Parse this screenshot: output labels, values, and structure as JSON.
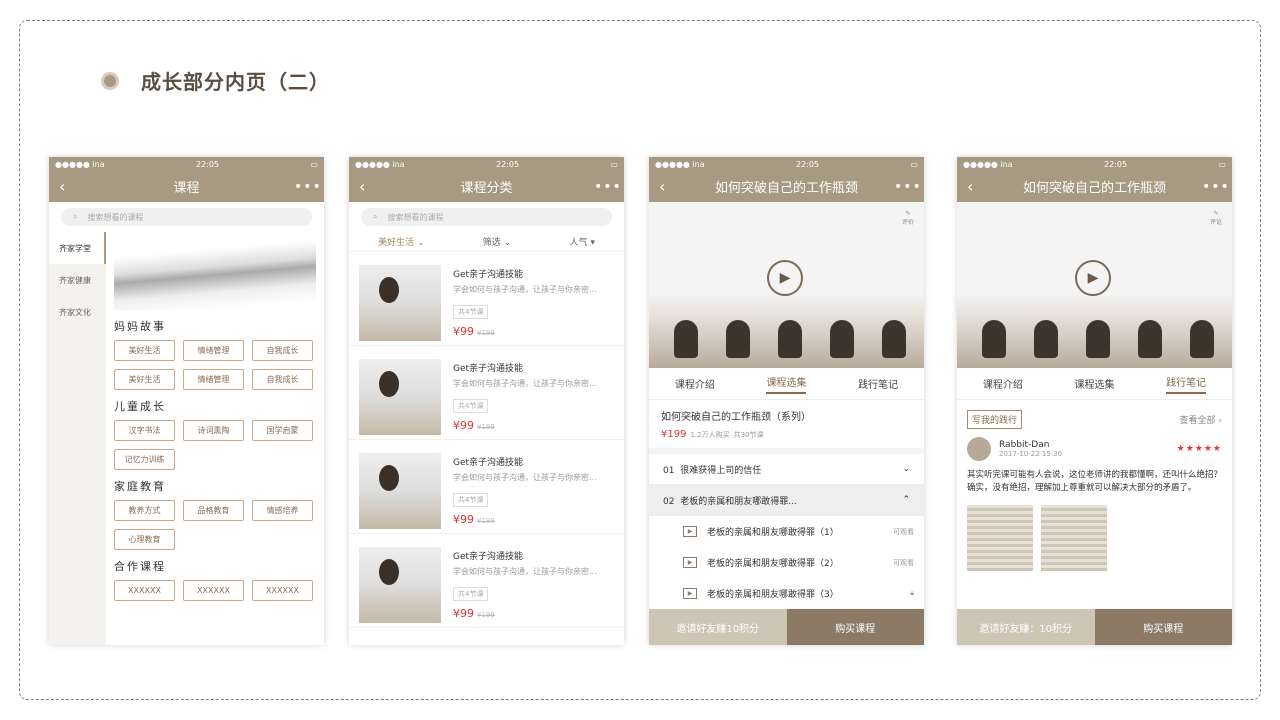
{
  "page": {
    "title": "成长部分内页（二）"
  },
  "status": {
    "carrier": "●●●●● ina",
    "time": "22:05"
  },
  "phone1": {
    "nav_title": "课程",
    "search_placeholder": "搜索想看的课程",
    "categories": [
      "齐家学堂",
      "齐家健康",
      "齐家文化"
    ],
    "sections": [
      {
        "title": "妈妈故事",
        "tags": [
          "美好生活",
          "情绪管理",
          "自我成长",
          "美好生活",
          "情绪管理",
          "自我成长"
        ]
      },
      {
        "title": "儿童成长",
        "tags": [
          "汉字书法",
          "诗词熏陶",
          "国学启蒙",
          "记忆力训练"
        ]
      },
      {
        "title": "家庭教育",
        "tags": [
          "教养方式",
          "品格教育",
          "情感培养",
          "心理教育"
        ]
      },
      {
        "title": "合作课程",
        "tags": [
          "XXXXXX",
          "XXXXXX",
          "XXXXXX"
        ]
      }
    ]
  },
  "phone2": {
    "nav_title": "课程分类",
    "search_placeholder": "搜索想看的课程",
    "filters": [
      "美好生活",
      "筛选",
      "人气"
    ],
    "courses": [
      {
        "title": "Get亲子沟通技能",
        "desc": "学会如何与孩子沟通，让孩子与你亲密...",
        "count": "共4节课",
        "price": "¥99",
        "old": "¥199"
      },
      {
        "title": "Get亲子沟通技能",
        "desc": "学会如何与孩子沟通，让孩子与你亲密...",
        "count": "共4节课",
        "price": "¥99",
        "old": "¥199"
      },
      {
        "title": "Get亲子沟通技能",
        "desc": "学会如何与孩子沟通，让孩子与你亲密...",
        "count": "共4节课",
        "price": "¥99",
        "old": "¥199"
      },
      {
        "title": "Get亲子沟通技能",
        "desc": "学会如何与孩子沟通，让孩子与你亲密...",
        "count": "共4节课",
        "price": "¥99",
        "old": "¥199"
      }
    ]
  },
  "phone3": {
    "nav_title": "如何突破自己的工作瓶颈",
    "review": "评价",
    "tabs": [
      "课程介绍",
      "课程选集",
      "践行笔记"
    ],
    "course_title": "如何突破自己的工作瓶颈（系列）",
    "price": "¥199",
    "buyers": "1.2万人购买",
    "lessons_total": "共30节课",
    "chapters": [
      {
        "no": "01",
        "title": "很难获得上司的信任"
      },
      {
        "no": "02",
        "title": "老板的亲属和朋友哪敢得罪..."
      }
    ],
    "lessons": [
      {
        "title": "老板的亲属和朋友哪敢得罪（1）",
        "status": "可观看"
      },
      {
        "title": "老板的亲属和朋友哪敢得罪（2）",
        "status": "可观看"
      },
      {
        "title": "老板的亲属和朋友哪敢得罪（3）",
        "status": ""
      }
    ],
    "invite": "邀请好友赚10积分",
    "buy": "购买课程"
  },
  "phone4": {
    "nav_title": "如何突破自己的工作瓶颈",
    "review": "评论",
    "tabs": [
      "课程介绍",
      "课程选集",
      "践行笔记"
    ],
    "write": "写我的践行",
    "view_all": "查看全部",
    "user": "Rabbit-Dan",
    "date": "2017-10-22 15:30",
    "stars": "★★★★★",
    "text": "其实听完课可能有人会说，这位老师讲的我都懂啊，还叫什么绝招？确实，没有绝招，理解加上尊重就可以解决大部分的矛盾了。",
    "invite": "邀请好友赚：10积分",
    "buy": "购买课程"
  }
}
